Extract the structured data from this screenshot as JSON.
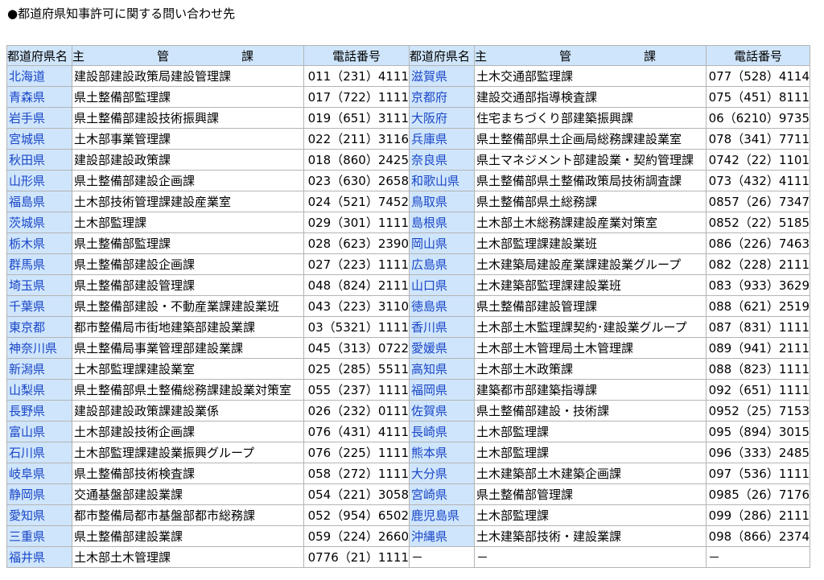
{
  "heading": "●都道府県知事許可に関する問い合わせ先",
  "headers": {
    "pref": "都道府県名",
    "dept": [
      "主",
      "管",
      "課"
    ],
    "phone": "電話番号"
  },
  "rows": [
    {
      "l_pref": "北海道",
      "l_dept": "建設部建設政策局建設管理課",
      "l_phone": "011（231）4111",
      "r_pref": "滋賀県",
      "r_dept": "土木交通部監理課",
      "r_phone": "077（528）4114"
    },
    {
      "l_pref": "青森県",
      "l_dept": "県土整備部監理課",
      "l_phone": "017（722）1111",
      "r_pref": "京都府",
      "r_dept": "建設交通部指導検査課",
      "r_phone": "075（451）8111"
    },
    {
      "l_pref": "岩手県",
      "l_dept": "県土整備部建設技術振興課",
      "l_phone": "019（651）3111",
      "r_pref": "大阪府",
      "r_dept": "住宅まちづくり部建築振興課",
      "r_phone": "06（6210）9735"
    },
    {
      "l_pref": "宮城県",
      "l_dept": "土木部事業管理課",
      "l_phone": "022（211）3116",
      "r_pref": "兵庫県",
      "r_dept": "県土整備部県土企画局総務課建設業室",
      "r_phone": "078（341）7711"
    },
    {
      "l_pref": "秋田県",
      "l_dept": "建設部建設政策課",
      "l_phone": "018（860）2425",
      "r_pref": "奈良県",
      "r_dept": "県土マネジメント部建設業・契約管理課",
      "r_phone": "0742（22）1101"
    },
    {
      "l_pref": "山形県",
      "l_dept": "県土整備部建設企画課",
      "l_phone": "023（630）2658",
      "r_pref": "和歌山県",
      "r_dept": "県土整備部県土整備政策局技術調査課",
      "r_phone": "073（432）4111"
    },
    {
      "l_pref": "福島県",
      "l_dept": "土木部技術管理課建設産業室",
      "l_phone": "024（521）7452",
      "r_pref": "鳥取県",
      "r_dept": "県土整備部県土総務課",
      "r_phone": "0857（26）7347"
    },
    {
      "l_pref": "茨城県",
      "l_dept": "土木部監理課",
      "l_phone": "029（301）1111",
      "r_pref": "島根県",
      "r_dept": "土木部土木総務課建設産業対策室",
      "r_phone": "0852（22）5185"
    },
    {
      "l_pref": "栃木県",
      "l_dept": "県土整備部監理課",
      "l_phone": "028（623）2390",
      "r_pref": "岡山県",
      "r_dept": "土木部監理課建設業班",
      "r_phone": "086（226）7463"
    },
    {
      "l_pref": "群馬県",
      "l_dept": "県土整備部建設企画課",
      "l_phone": "027（223）1111",
      "r_pref": "広島県",
      "r_dept": "土木建築局建設産業課建設業グループ",
      "r_phone": "082（228）2111"
    },
    {
      "l_pref": "埼玉県",
      "l_dept": "県土整備部建設管理課",
      "l_phone": "048（824）2111",
      "r_pref": "山口県",
      "r_dept": "土木建築部監理課建設業班",
      "r_phone": "083（933）3629"
    },
    {
      "l_pref": "千葉県",
      "l_dept": "県土整備部建設・不動産業課建設業班",
      "l_phone": "043（223）3110",
      "r_pref": "徳島県",
      "r_dept": "県土整備部建設管理課",
      "r_phone": "088（621）2519"
    },
    {
      "l_pref": "東京都",
      "l_dept": "都市整備局市街地建築部建設業課",
      "l_phone": "03（5321）1111",
      "r_pref": "香川県",
      "r_dept": "土木部土木監理課契約･建設業グループ",
      "r_phone": "087（831）1111"
    },
    {
      "l_pref": "神奈川県",
      "l_dept": "県土整備局事業管理部建設業課",
      "l_phone": "045（313）0722",
      "r_pref": "愛媛県",
      "r_dept": "土木部土木管理局土木管理課",
      "r_phone": "089（941）2111"
    },
    {
      "l_pref": "新潟県",
      "l_dept": "土木部監理課建設業室",
      "l_phone": "025（285）5511",
      "r_pref": "高知県",
      "r_dept": "土木部土木政策課",
      "r_phone": "088（823）1111"
    },
    {
      "l_pref": "山梨県",
      "l_dept": "県土整備部県土整備総務課建設業対策室",
      "l_phone": "055（237）1111",
      "r_pref": "福岡県",
      "r_dept": "建築都市部建築指導課",
      "r_phone": "092（651）1111"
    },
    {
      "l_pref": "長野県",
      "l_dept": "建設部建設政策課建設業係",
      "l_phone": "026（232）0111",
      "r_pref": "佐賀県",
      "r_dept": "県土整備部建設・技術課",
      "r_phone": "0952（25）7153"
    },
    {
      "l_pref": "富山県",
      "l_dept": "土木部建設技術企画課",
      "l_phone": "076（431）4111",
      "r_pref": "長崎県",
      "r_dept": "土木部監理課",
      "r_phone": "095（894）3015"
    },
    {
      "l_pref": "石川県",
      "l_dept": "土木部監理課建設業振興グループ",
      "l_phone": "076（225）1111",
      "r_pref": "熊本県",
      "r_dept": "土木部監理課",
      "r_phone": "096（333）2485"
    },
    {
      "l_pref": "岐阜県",
      "l_dept": "県土整備部技術検査課",
      "l_phone": "058（272）1111",
      "r_pref": "大分県",
      "r_dept": "土木建築部土木建築企画課",
      "r_phone": "097（536）1111"
    },
    {
      "l_pref": "静岡県",
      "l_dept": "交通基盤部建設業課",
      "l_phone": "054（221）3058",
      "r_pref": "宮崎県",
      "r_dept": "県土整備部管理課",
      "r_phone": "0985（26）7176"
    },
    {
      "l_pref": "愛知県",
      "l_dept": "都市整備局都市基盤部都市総務課",
      "l_phone": "052（954）6502",
      "r_pref": "鹿児島県",
      "r_dept": "土木部監理課",
      "r_phone": "099（286）2111"
    },
    {
      "l_pref": "三重県",
      "l_dept": "県土整備部建設業課",
      "l_phone": "059（224）2660",
      "r_pref": "沖縄県",
      "r_dept": "土木建築部技術・建設業課",
      "r_phone": "098（866）2374"
    },
    {
      "l_pref": "福井県",
      "l_dept": "土木部土木管理課",
      "l_phone": "0776（21）1111",
      "r_pref": "－",
      "r_dept": "－",
      "r_phone": "－"
    }
  ]
}
